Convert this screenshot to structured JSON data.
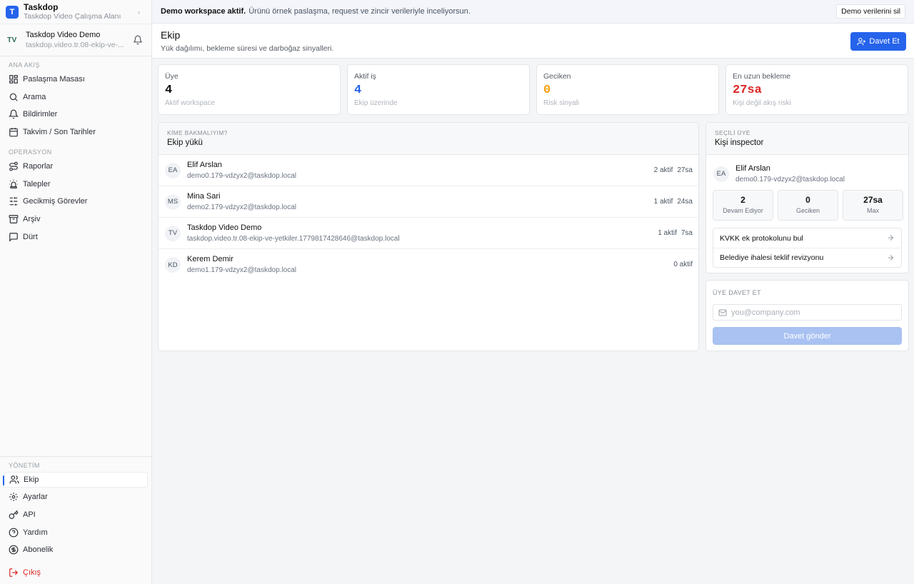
{
  "brand": {
    "logo_letter": "T",
    "name": "Taskdop",
    "subtitle": "Taskdop Video Çalışma Alanı"
  },
  "workspace": {
    "avatar": "TV",
    "name": "Taskdop Video Demo",
    "subtitle": "taskdop.video.tr.08-ekip-ve-..."
  },
  "sidebar": {
    "section_main": "ANA AKIŞ",
    "main_items": [
      {
        "label": "Paslaşma Masası",
        "icon": "grid-icon"
      },
      {
        "label": "Arama",
        "icon": "search-icon"
      },
      {
        "label": "Bildirimler",
        "icon": "bell-icon"
      },
      {
        "label": "Takvim / Son Tarihler",
        "icon": "calendar-icon"
      }
    ],
    "section_ops": "OPERASYON",
    "ops_items": [
      {
        "label": "Raporlar",
        "icon": "route-icon"
      },
      {
        "label": "Talepler",
        "icon": "siren-icon"
      },
      {
        "label": "Gecikmiş Görevler",
        "icon": "sliders-icon"
      },
      {
        "label": "Arşiv",
        "icon": "archive-icon"
      },
      {
        "label": "Dürt",
        "icon": "message-icon"
      }
    ],
    "section_admin": "YÖNETİM",
    "admin_items": [
      {
        "label": "Ekip",
        "icon": "users-icon",
        "active": true
      },
      {
        "label": "Ayarlar",
        "icon": "gear-icon"
      },
      {
        "label": "API",
        "icon": "key-icon"
      },
      {
        "label": "Yardım",
        "icon": "help-icon"
      },
      {
        "label": "Abonelik",
        "icon": "dollar-icon"
      }
    ],
    "logout": "Çıkış"
  },
  "banner": {
    "strong": "Demo workspace aktif.",
    "text": "Ürünü örnek paslaşma, request ve zincir verileriyle inceliyorsun.",
    "button": "Demo verilerini sil"
  },
  "page": {
    "title": "Ekip",
    "subtitle": "Yük dağılımı, bekleme süresi ve darboğaz sinyalleri.",
    "invite_button": "Davet Et"
  },
  "stats": [
    {
      "label": "Üye",
      "value": "4",
      "sub": "Aktif workspace",
      "color": "#111111"
    },
    {
      "label": "Aktif iş",
      "value": "4",
      "sub": "Ekip üzerinde",
      "color": "#2563eb"
    },
    {
      "label": "Geciken",
      "value": "0",
      "sub": "Risk sinyali",
      "color": "#f59e0b"
    },
    {
      "label": "En uzun bekleme",
      "value": "27sa",
      "sub": "Kişi değil akış riski",
      "color": "#dc2626"
    }
  ],
  "team": {
    "eyebrow": "KİME BAKMALIYIM?",
    "title": "Ekip yükü",
    "members": [
      {
        "initials": "EA",
        "name": "Elif Arslan",
        "email": "demo0.179-vdzyx2@taskdop.local",
        "active": "2 aktif",
        "wait": "27sa"
      },
      {
        "initials": "MS",
        "name": "Mina Sari",
        "email": "demo2.179-vdzyx2@taskdop.local",
        "active": "1 aktif",
        "wait": "24sa"
      },
      {
        "initials": "TV",
        "name": "Taskdop Video Demo",
        "email": "taskdop.video.tr.08-ekip-ve-yetkiler.1779817428646@taskdop.local",
        "active": "1 aktif",
        "wait": "7sa"
      },
      {
        "initials": "KD",
        "name": "Kerem Demir",
        "email": "demo1.179-vdzyx2@taskdop.local",
        "active": "0 aktif",
        "wait": ""
      }
    ]
  },
  "inspector": {
    "eyebrow": "SEÇİLİ ÜYE",
    "title": "Kişi inspector",
    "person": {
      "initials": "EA",
      "name": "Elif Arslan",
      "email": "demo0.179-vdzyx2@taskdop.local"
    },
    "mini_stats": [
      {
        "value": "2",
        "label": "Devam Ediyor"
      },
      {
        "value": "0",
        "label": "Geciken"
      },
      {
        "value": "27sa",
        "label": "Max"
      }
    ],
    "tasks": [
      {
        "label": "KVKK ek protokolunu bul"
      },
      {
        "label": "Belediye ihalesi teklif revizyonu"
      }
    ]
  },
  "invite": {
    "eyebrow": "ÜYE DAVET ET",
    "placeholder": "you@company.com",
    "button": "Davet gönder"
  }
}
